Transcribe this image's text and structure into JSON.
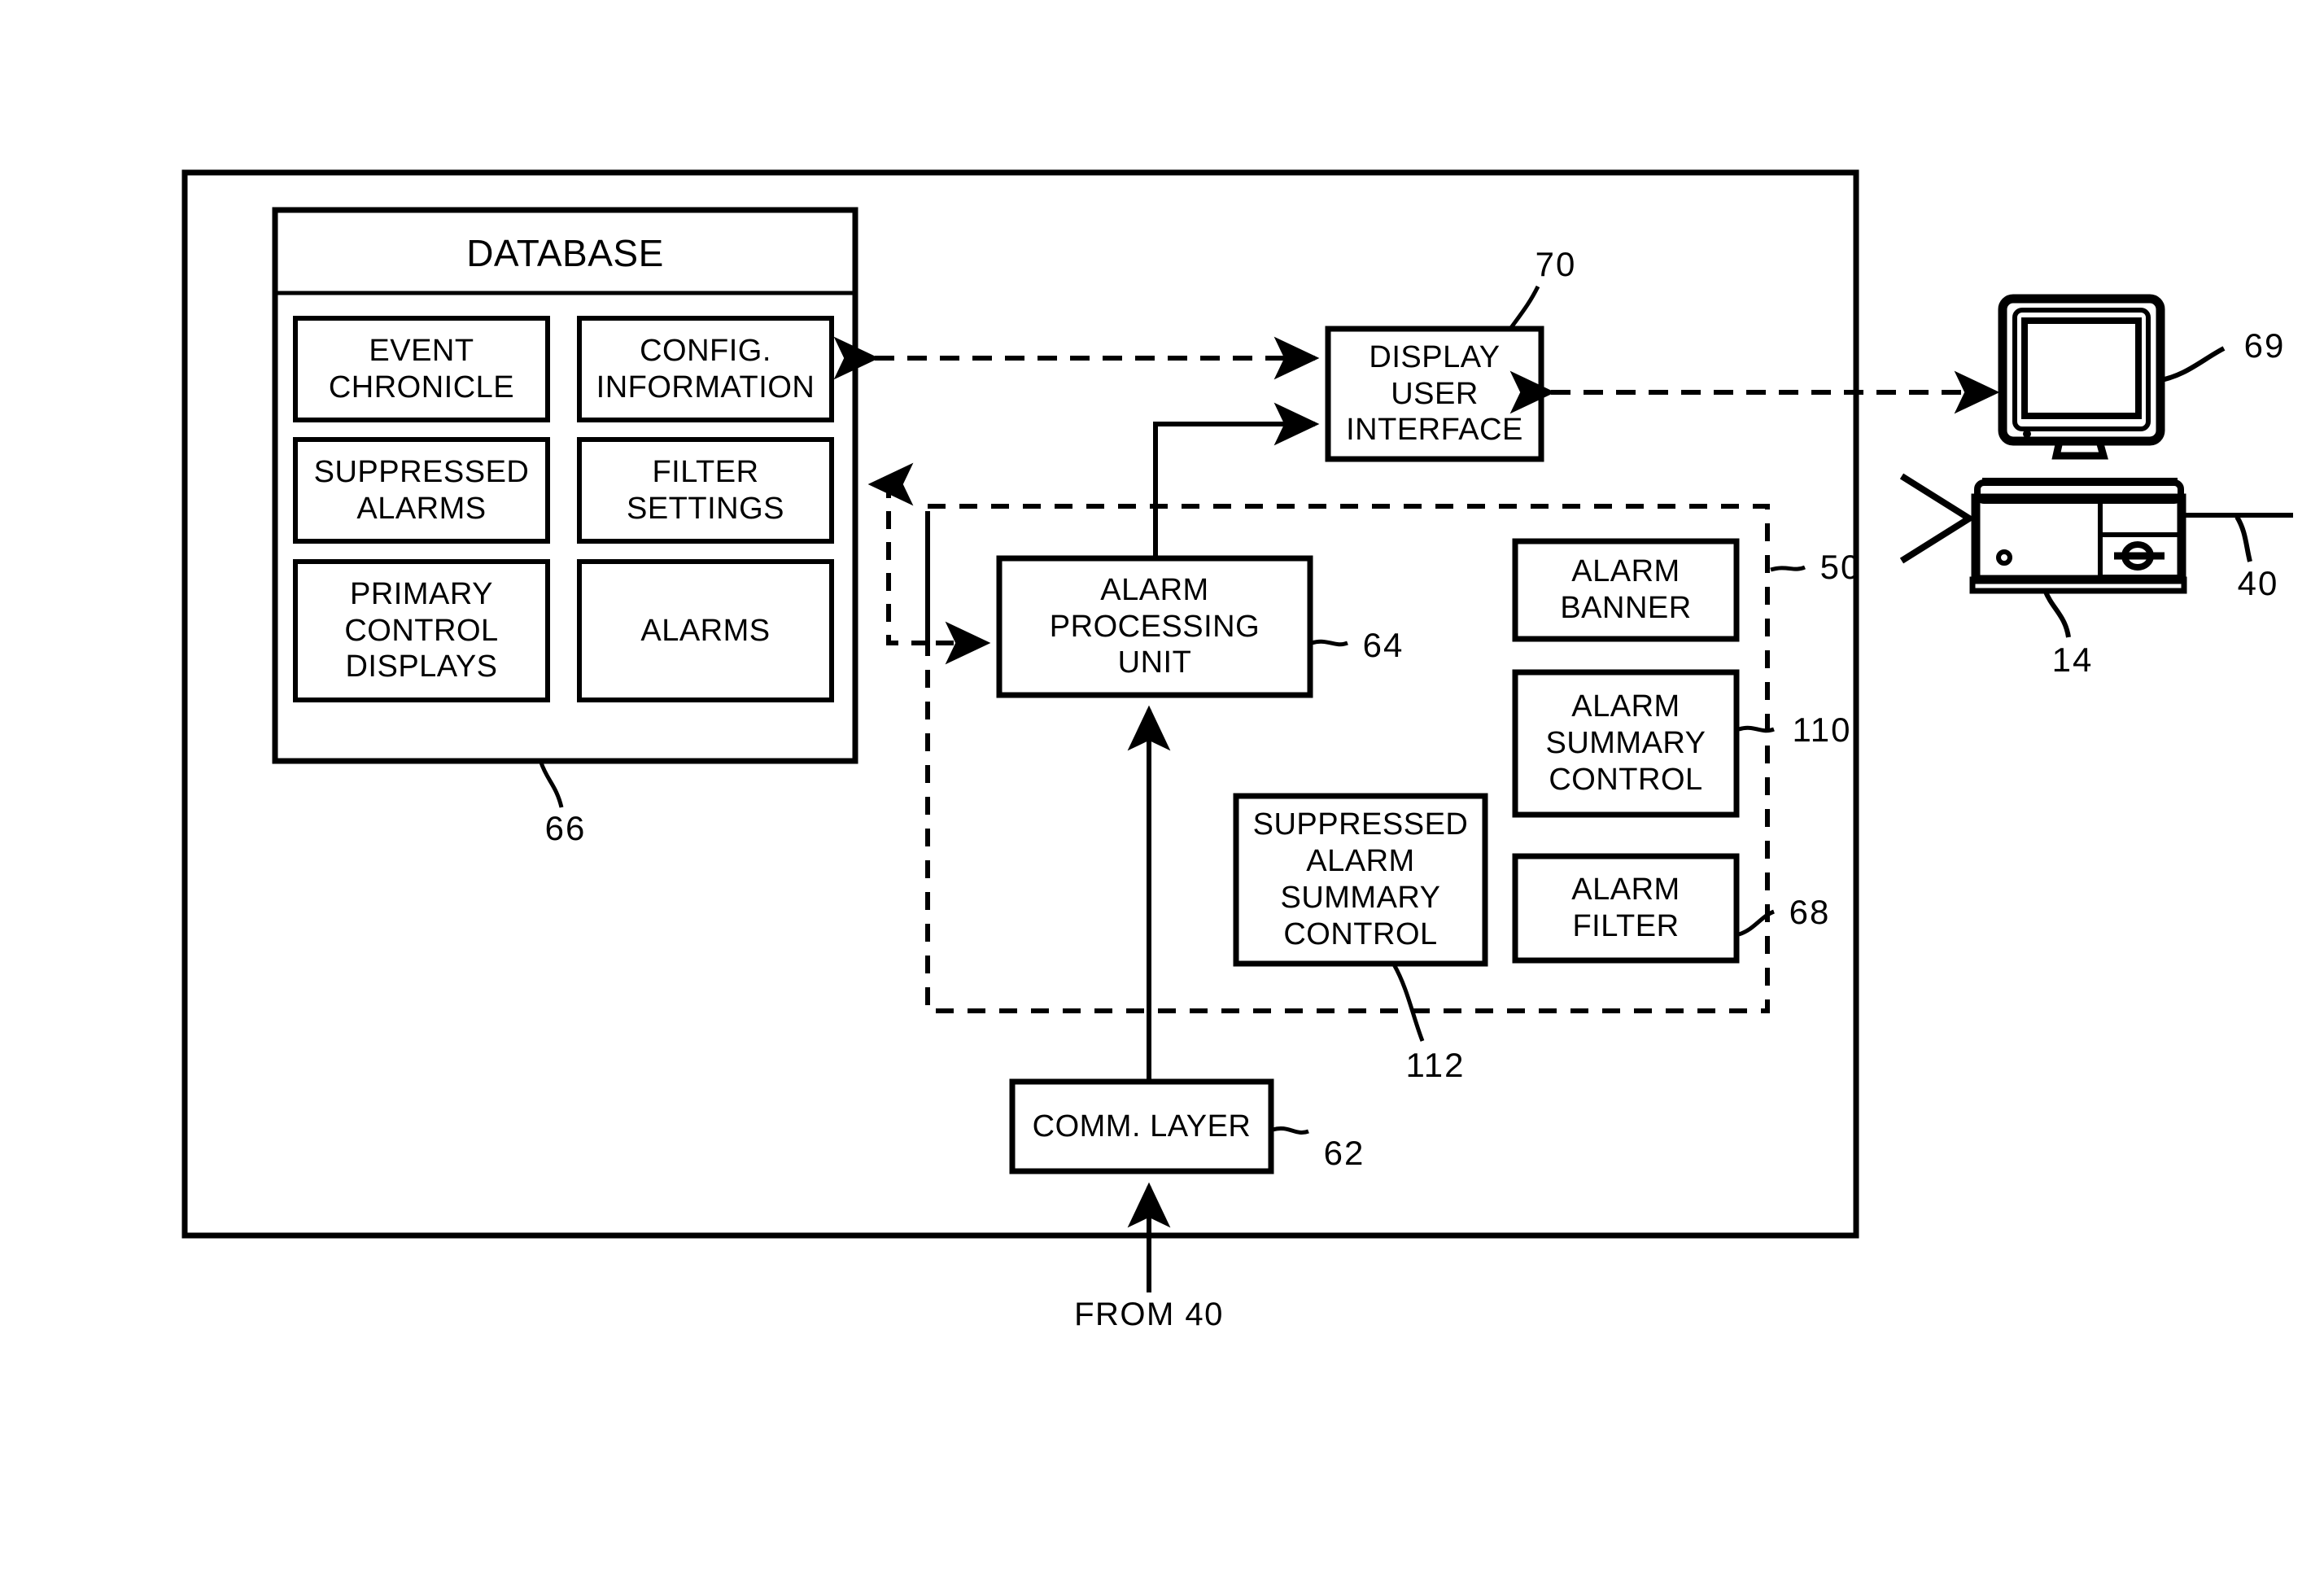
{
  "figure": {
    "type": "patent-block-diagram",
    "outer_system": {
      "name": "system-boundary",
      "boxes": {
        "database": {
          "title": "DATABASE",
          "ref": "66",
          "items": [
            "EVENT\nCHRONICLE",
            "CONFIG.\nINFORMATION",
            "SUPPRESSED\nALARMS",
            "FILTER\nSETTINGS",
            "PRIMARY\nCONTROL\nDISPLAYS",
            "ALARMS"
          ]
        },
        "display_user_interface": {
          "label": "DISPLAY\nUSER\nINTERFACE",
          "ref": "70"
        },
        "alarm_processing_unit": {
          "label": "ALARM\nPROCESSING\nUNIT",
          "ref": "64"
        },
        "comm_layer": {
          "label": "COMM. LAYER",
          "ref": "62"
        },
        "suppressed_alarm_summary_control": {
          "label": "SUPPRESSED\nALARM\nSUMMARY\nCONTROL",
          "ref": "112"
        },
        "alarm_banner": {
          "label": "ALARM\nBANNER"
        },
        "alarm_summary_control": {
          "label": "ALARM\nSUMMARY\nCONTROL",
          "ref": "110"
        },
        "alarm_filter": {
          "label": "ALARM\nFILTER",
          "ref": "68"
        }
      },
      "dashed_group": {
        "ref": "50"
      }
    },
    "workstation": {
      "monitor_ref": "69",
      "base_ref": "14",
      "system_ref": "40"
    },
    "annotations": {
      "from_source": "FROM 40"
    },
    "colors": {
      "ink": "#000000",
      "paper": "#ffffff"
    }
  }
}
